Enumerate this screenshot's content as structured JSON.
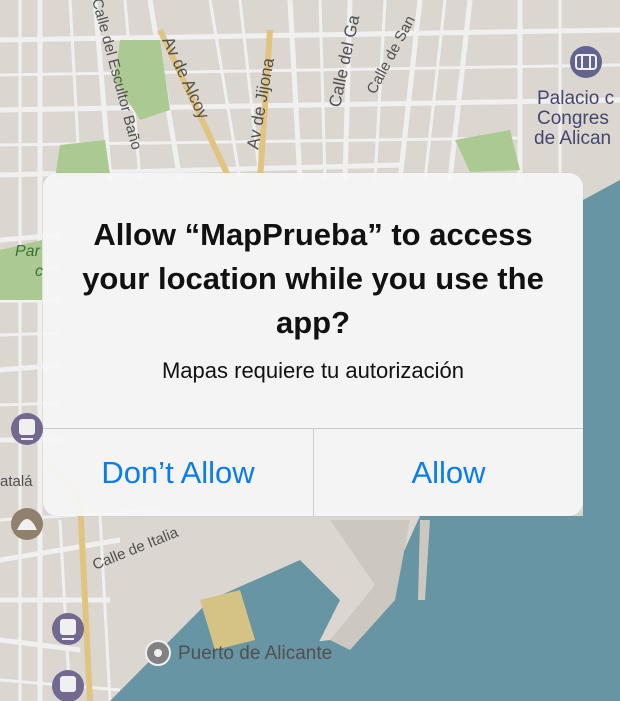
{
  "alert": {
    "title": "Allow “MapPrueba” to access your location while you use the app?",
    "message": "Mapas requiere tu autorización",
    "buttons": {
      "cancel": "Don’t Allow",
      "confirm": "Allow"
    }
  },
  "map": {
    "street_labels": {
      "escultor": "Calle del Escultor Baño",
      "alcoy": "Av de Alcoy",
      "jijona": "Av de Jijona",
      "calle_gal": "Calle del Ga",
      "calle_san": "Calle de San",
      "calle_ita": "Calle de Italia",
      "parque": "Par",
      "parque2": "c",
      "atala": "atalá"
    },
    "poi_labels": {
      "palacio_line1": "Palacio c",
      "palacio_line2": "Congres",
      "palacio_line3": "de Alican",
      "puerto": "Puerto de Alicante"
    },
    "icons": [
      "stadium-icon",
      "train-icon",
      "train-icon",
      "train-icon",
      "ship-icon",
      "shell-icon",
      "pin-icon"
    ],
    "colors": {
      "land": "#eae6df",
      "water": "#6f9fae",
      "park": "#b7d99c",
      "port": "#e2cf8f",
      "road": "#ffffff",
      "highway": "#f1d28a"
    }
  }
}
